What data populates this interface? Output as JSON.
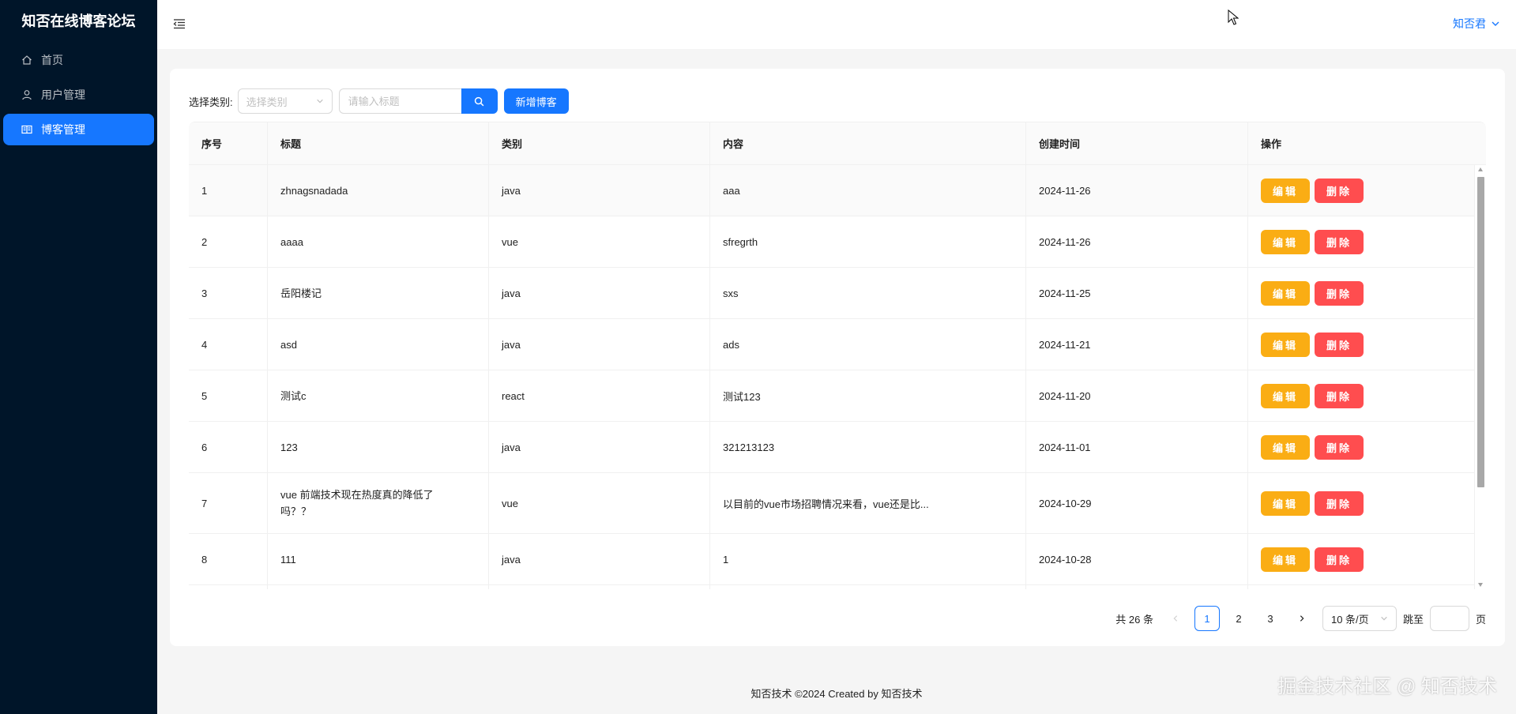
{
  "app": {
    "title": "知否在线博客论坛"
  },
  "sidebar": {
    "items": [
      {
        "label": "首页",
        "icon": "home-icon"
      },
      {
        "label": "用户管理",
        "icon": "user-icon"
      },
      {
        "label": "博客管理",
        "icon": "book-icon",
        "active": true
      }
    ]
  },
  "header": {
    "username": "知否君"
  },
  "toolbar": {
    "category_label": "选择类别:",
    "category_placeholder": "选择类别",
    "search_placeholder": "请输入标题",
    "add_label": "新增博客"
  },
  "table": {
    "columns": [
      "序号",
      "标题",
      "类别",
      "内容",
      "创建时间",
      "操作"
    ],
    "edit_label": "编辑",
    "delete_label": "删除",
    "rows": [
      {
        "no": "1",
        "title": "zhnagsnadada",
        "category": "java",
        "content": "aaa",
        "created": "2024-11-26"
      },
      {
        "no": "2",
        "title": "aaaa",
        "category": "vue",
        "content": "sfregrth",
        "created": "2024-11-26"
      },
      {
        "no": "3",
        "title": "岳阳楼记",
        "category": "java",
        "content": "sxs",
        "created": "2024-11-25"
      },
      {
        "no": "4",
        "title": "asd",
        "category": "java",
        "content": "ads",
        "created": "2024-11-21"
      },
      {
        "no": "5",
        "title": "测试c",
        "category": "react",
        "content": "测试123",
        "created": "2024-11-20"
      },
      {
        "no": "6",
        "title": "123",
        "category": "java",
        "content": "321213123",
        "created": "2024-11-01"
      },
      {
        "no": "7",
        "title": "vue 前端技术现在热度真的降低了吗？？",
        "category": "vue",
        "content": "以目前的vue市场招聘情况来看，vue还是比...",
        "created": "2024-10-29"
      },
      {
        "no": "8",
        "title": "111",
        "category": "java",
        "content": "1",
        "created": "2024-10-28"
      }
    ]
  },
  "pagination": {
    "total_label": "共 26 条",
    "pages": [
      "1",
      "2",
      "3"
    ],
    "current": "1",
    "page_size": "10 条/页",
    "jump_label": "跳至",
    "page_unit": "页"
  },
  "footer": {
    "text": "知否技术 ©2024 Created by 知否技术"
  },
  "watermark": "掘金技术社区 @ 知否技术",
  "colors": {
    "primary": "#1677ff",
    "sider": "#001529",
    "edit": "#faad14",
    "delete": "#ff4d4f"
  }
}
